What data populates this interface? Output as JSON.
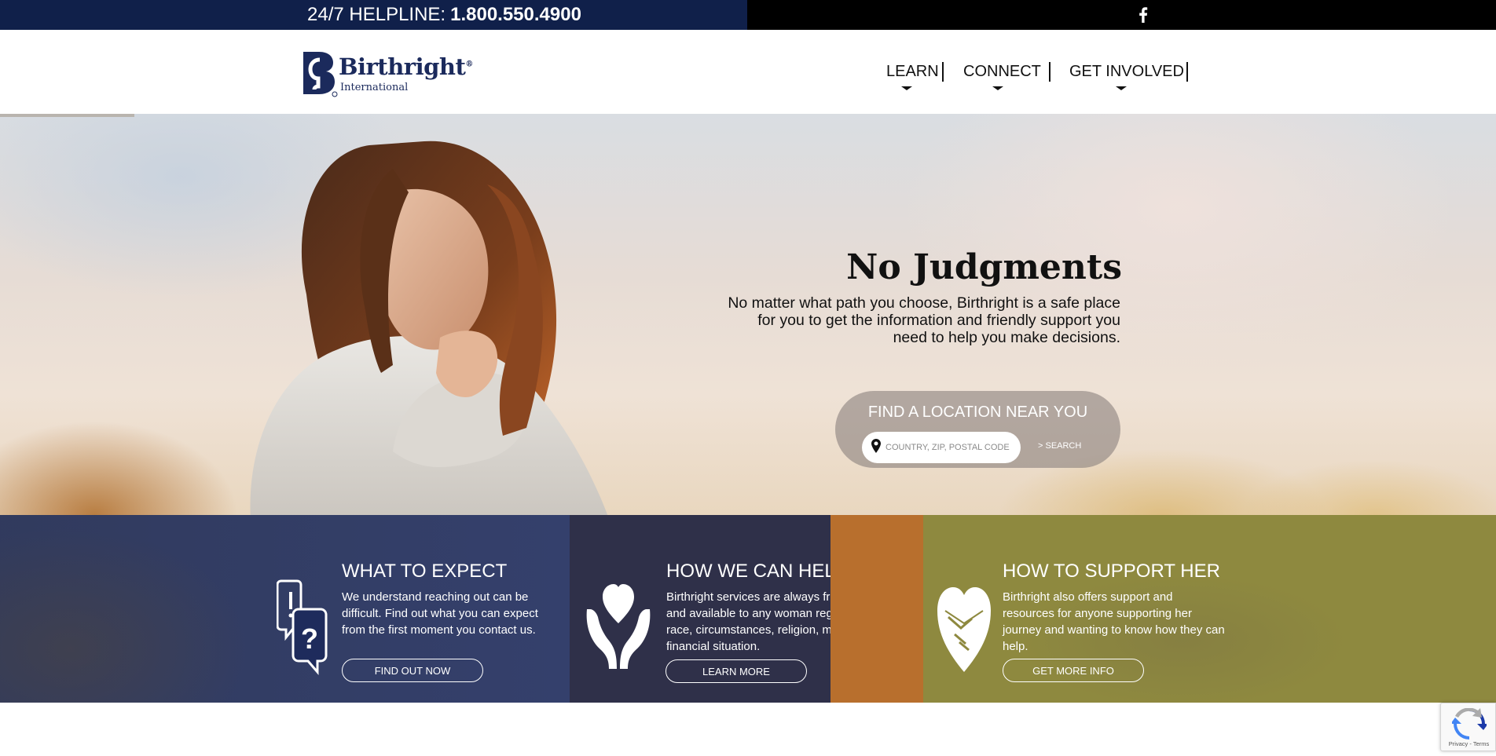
{
  "topbar": {
    "helpline_label": "24/7 HELPLINE:",
    "helpline_number": "1.800.550.4900",
    "social_icon": "facebook-icon",
    "colors": {
      "left_bg": "#10204a",
      "right_bg": "#000000"
    }
  },
  "header": {
    "logo": {
      "name": "Birthright",
      "reg": "®",
      "sub": "International",
      "color": "#1b2a5c"
    },
    "nav": [
      {
        "label": "LEARN"
      },
      {
        "label": "CONNECT"
      },
      {
        "label": "GET INVOLVED"
      }
    ]
  },
  "hero": {
    "slider_progress": 0.09,
    "title": "No Judgments",
    "text": "No matter what path you choose, Birthright is a safe place for you to get the information and friendly support you need to help you make decisions.",
    "finder": {
      "title": "FIND A LOCATION NEAR YOU",
      "placeholder": "COUNTRY, ZIP, POSTAL CODE",
      "search_label": "> SEARCH",
      "icon": "map-pin-icon"
    }
  },
  "panels": [
    {
      "title": "WHAT TO EXPECT",
      "text": "We understand reaching out can be difficult. Find out what you can expect from the first moment you contact us.",
      "button": "FIND OUT NOW",
      "icon": "question-chat-icon",
      "color": "#1e2b5c"
    },
    {
      "title": "HOW WE CAN HELP",
      "text": "Birthright services are always free, confidential and available to any woman regardless of age, race, circumstances, religion, marital status or financial situation.",
      "button": "LEARN MORE",
      "icon": "hands-heart-icon",
      "color": "#2f3049"
    },
    {
      "title": "HOW TO SUPPORT HER",
      "text": "Birthright also offers support and resources for anyone supporting her journey and wanting to know how they can help.",
      "button": "GET MORE INFO",
      "icon": "handshake-heart-icon",
      "color": "#8e893f"
    }
  ],
  "recaptcha": {
    "text": "Privacy - Terms",
    "icon": "recaptcha-icon"
  }
}
